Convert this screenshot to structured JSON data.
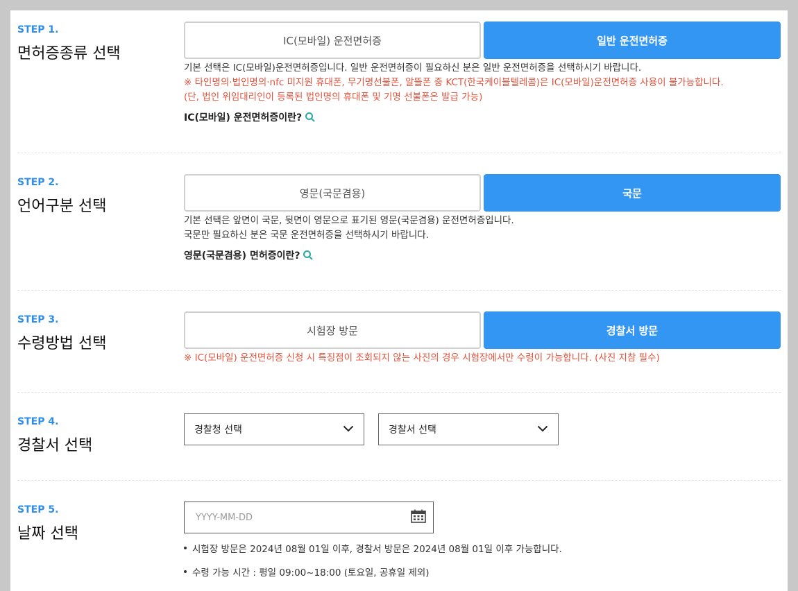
{
  "steps": [
    {
      "num": "STEP 1.",
      "title": "면허증종류 선택",
      "options": [
        "IC(모바일) 운전면허증",
        "일반 운전면허증"
      ],
      "selected_index": 1,
      "desc": [
        "기본 선택은 IC(모바일)운전면허증입니다. 일반 운전면허증이 필요하신 분은 일반 운전면허증을 선택하시기 바랍니다."
      ],
      "warnings": [
        "※ 타인명의·법인명의·nfc 미지원 휴대폰, 무기명선불폰, 알뜰폰 중 KCT(한국케이블텔레콤)은 IC(모바일)운전면허증 사용이 불가능합니다.",
        "(단, 법인 위임대리인이 등록된 법인명의 휴대폰 및 기명 선불폰은 발급 가능)"
      ],
      "help": "IC(모바일) 운전면허증이란?"
    },
    {
      "num": "STEP 2.",
      "title": "언어구분 선택",
      "options": [
        "영문(국문겸용)",
        "국문"
      ],
      "selected_index": 1,
      "desc": [
        "기본 선택은 앞면이 국문, 뒷면이 영문으로 표기된 영문(국문겸용) 운전면허증입니다.",
        "국문만 필요하신 분은 국문 운전면허증을 선택하시기 바랍니다."
      ],
      "help": "영문(국문겸용) 면허증이란?"
    },
    {
      "num": "STEP 3.",
      "title": "수령방법 선택",
      "options": [
        "시험장 방문",
        "경찰서 방문"
      ],
      "selected_index": 1,
      "warnings": [
        "※ IC(모바일) 운전면허증 신청 시 특징점이 조회되지 않는 사진의 경우 시험장에서만 수령이 가능합니다. (사진 지참 필수)"
      ]
    },
    {
      "num": "STEP 4.",
      "title": "경찰서 선택",
      "selects": [
        "경찰청 선택",
        "경찰서 선택"
      ]
    },
    {
      "num": "STEP 5.",
      "title": "날짜 선택",
      "date_placeholder": "YYYY-MM-DD",
      "notes": [
        "시험장 방문은 2024년 08월 01일 이후, 경찰서 방문은 2024년 08월 01일 이후 가능합니다.",
        "수령 가능 시간 : 평일 09:00~18:00 (토요일, 공휴일 제외)"
      ]
    }
  ],
  "colors": {
    "accent": "#3396f3",
    "step_label": "#2f8ee8",
    "warning": "#e4523b",
    "search_icon": "#2aa9a0"
  },
  "icons": {
    "search": "search-icon",
    "chevron": "chevron-down-icon",
    "calendar": "calendar-icon"
  }
}
